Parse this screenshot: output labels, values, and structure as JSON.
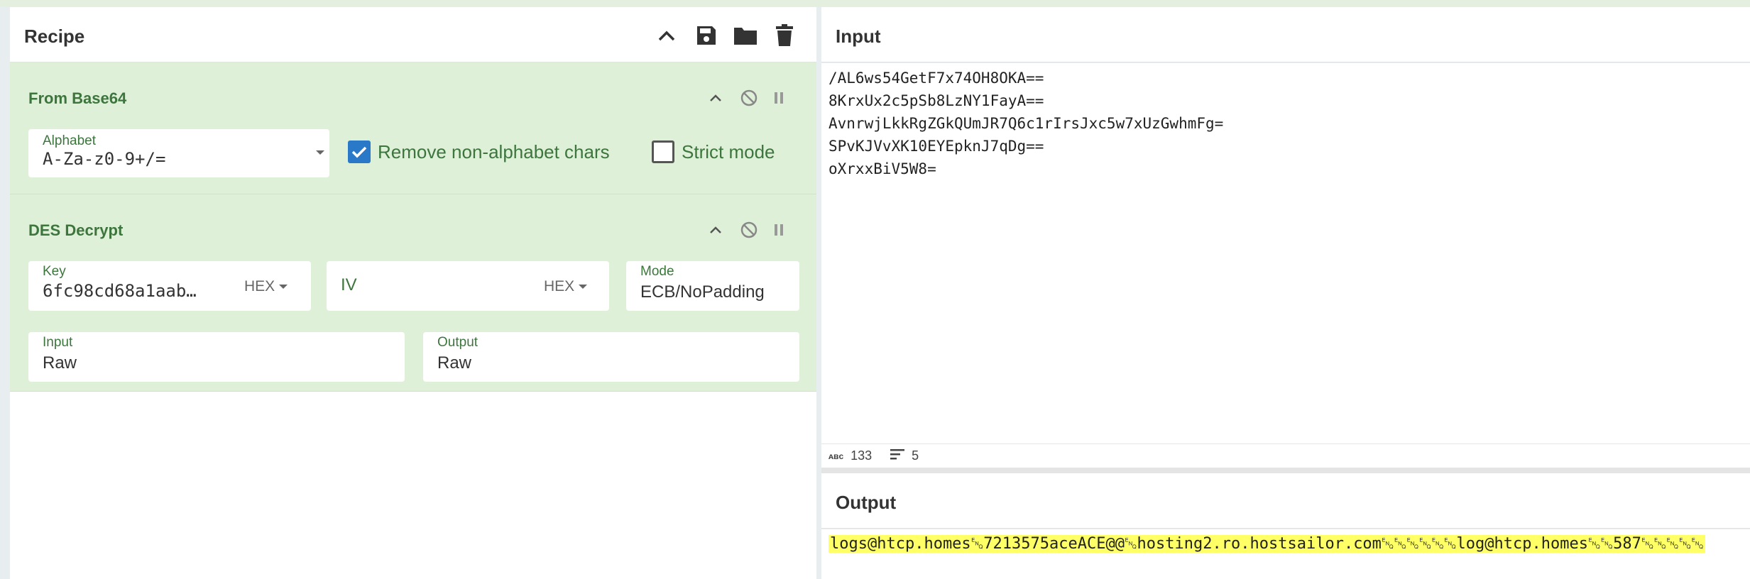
{
  "recipe": {
    "title": "Recipe",
    "operations": [
      {
        "name": "From Base64",
        "alphabet_label": "Alphabet",
        "alphabet_value": "A-Za-z0-9+/=",
        "remove_label": "Remove non-alphabet chars",
        "remove_checked": true,
        "strict_label": "Strict mode",
        "strict_checked": false
      },
      {
        "name": "DES Decrypt",
        "key_label": "Key",
        "key_value": "6fc98cd68a1aab…",
        "key_format": "HEX",
        "iv_label": "IV",
        "iv_format": "HEX",
        "mode_label": "Mode",
        "mode_value": "ECB/NoPadding",
        "input_label": "Input",
        "input_value": "Raw",
        "output_label": "Output",
        "output_value": "Raw"
      }
    ]
  },
  "input": {
    "title": "Input",
    "lines": [
      "/AL6ws54GetF7x74OH8OKA==",
      "8KrxUx2c5pSb8LzNY1FayA==",
      "AvnrwjLkkRgZGkQUmJR7Q6c1rIrsJxc5w7xUzGwhmFg=",
      "SPvKJVvXK10EYEpknJ7qDg==",
      "oXrxxBiV5W8="
    ],
    "char_count": "133",
    "line_count": "5"
  },
  "output": {
    "title": "Output",
    "text": "logs@htcp.homes␅7213575aceACE@@␅hosting2.ro.hostsailor.com␅␅␅␅␅␅log@htcp.homes␅␅587␅␅␅␅␅"
  },
  "colors": {
    "op_bg": "#dff0d8",
    "op_text": "#3c763d",
    "checkbox_on": "#2a79c9",
    "output_highlight": "#ffff66"
  }
}
